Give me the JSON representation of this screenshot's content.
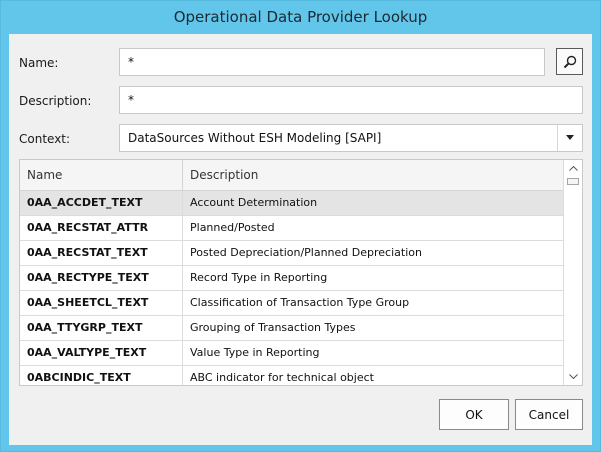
{
  "window": {
    "title": "Operational Data Provider Lookup"
  },
  "form": {
    "name_label": "Name:",
    "name_value": "*",
    "description_label": "Description:",
    "description_value": "*",
    "context_label": "Context:",
    "context_value": "DataSources Without ESH Modeling [SAPI]"
  },
  "grid": {
    "columns": [
      "Name",
      "Description"
    ],
    "rows": [
      {
        "name": "0AA_ACCDET_TEXT",
        "description": "Account Determination"
      },
      {
        "name": "0AA_RECSTAT_ATTR",
        "description": "Planned/Posted"
      },
      {
        "name": "0AA_RECSTAT_TEXT",
        "description": "Posted Depreciation/Planned Depreciation"
      },
      {
        "name": "0AA_RECTYPE_TEXT",
        "description": "Record Type in Reporting"
      },
      {
        "name": "0AA_SHEETCL_TEXT",
        "description": "Classification of Transaction Type Group"
      },
      {
        "name": "0AA_TTYGRP_TEXT",
        "description": "Grouping of Transaction Types"
      },
      {
        "name": "0AA_VALTYPE_TEXT",
        "description": "Value Type in Reporting"
      },
      {
        "name": "0ABCINDIC_TEXT",
        "description": "ABC indicator for technical object"
      }
    ],
    "selected_row": 0
  },
  "buttons": {
    "ok": "OK",
    "cancel": "Cancel"
  },
  "icons": {
    "search": "search-icon",
    "dropdown": "chevron-down-icon",
    "scroll_up": "chevron-up-icon",
    "scroll_down": "chevron-down-icon"
  },
  "colors": {
    "title_bar": "#62c6ea",
    "client_bg": "#f0f0f0",
    "selected_row": "#e4e4e4"
  }
}
